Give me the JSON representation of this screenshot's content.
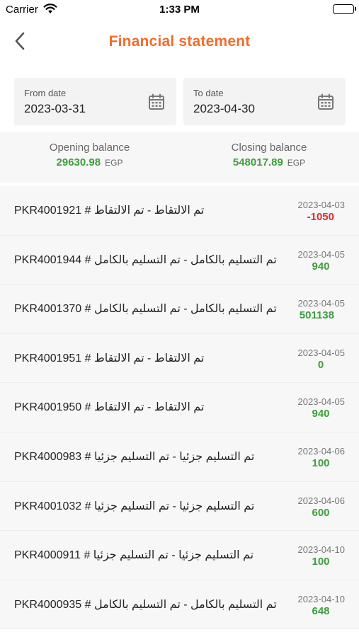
{
  "status_bar": {
    "carrier": "Carrier",
    "time": "1:33 PM"
  },
  "nav": {
    "title": "Financial statement",
    "accent_color": "#f26b2b"
  },
  "filters": {
    "from_label": "From date",
    "from_value": "2023-03-31",
    "to_label": "To date",
    "to_value": "2023-04-30"
  },
  "balance": {
    "opening_label": "Opening balance",
    "opening_amount": "29630.98",
    "opening_currency": "EGP",
    "closing_label": "Closing balance",
    "closing_amount": "548017.89",
    "closing_currency": "EGP",
    "positive_color": "#3d9e3d",
    "negative_color": "#e02a2a"
  },
  "transactions": [
    {
      "description": "تم الالتقاط - تم الالتقاط # PKR4001921",
      "date": "2023-04-03",
      "amount": "-1050"
    },
    {
      "description": "تم التسليم بالكامل - تم التسليم بالكامل # PKR4001944",
      "date": "2023-04-05",
      "amount": "940"
    },
    {
      "description": "تم التسليم بالكامل - تم التسليم بالكامل # PKR4001370",
      "date": "2023-04-05",
      "amount": "501138"
    },
    {
      "description": "تم الالتقاط - تم الالتقاط # PKR4001951",
      "date": "2023-04-05",
      "amount": "0"
    },
    {
      "description": "تم الالتقاط - تم الالتقاط # PKR4001950",
      "date": "2023-04-05",
      "amount": "940"
    },
    {
      "description": "تم التسليم جزئيا - تم التسليم جزئيا # PKR4000983",
      "date": "2023-04-06",
      "amount": "100"
    },
    {
      "description": "تم التسليم جزئيا - تم التسليم جزئيا # PKR4001032",
      "date": "2023-04-06",
      "amount": "600"
    },
    {
      "description": "تم التسليم جزئيا - تم التسليم جزئيا # PKR4000911",
      "date": "2023-04-10",
      "amount": "100"
    },
    {
      "description": "تم التسليم بالكامل - تم التسليم بالكامل # PKR4000935",
      "date": "2023-04-10",
      "amount": "648"
    }
  ]
}
